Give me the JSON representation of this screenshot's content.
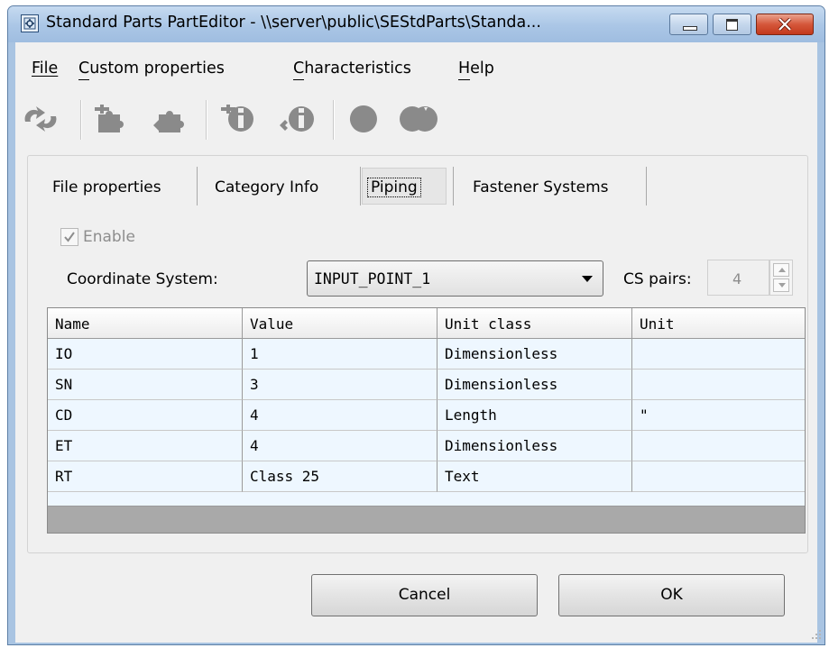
{
  "window": {
    "title": "Standard Parts PartEditor - \\\\server\\public\\SEStdParts\\Standa...",
    "caption_buttons": [
      "minimize",
      "maximize",
      "close"
    ]
  },
  "menu": [
    {
      "label": "File",
      "mnemonic": "F"
    },
    {
      "label": "Custom properties",
      "mnemonic": "C"
    },
    {
      "label": "Characteristics",
      "mnemonic": "C"
    },
    {
      "label": "Help",
      "mnemonic": "H"
    }
  ],
  "toolbar": {
    "icons": [
      "refresh-icon",
      "puzzle-add-icon",
      "puzzle-remove-icon",
      "info-add-icon",
      "info-remove-icon",
      "circle-icon",
      "double-circle-icon"
    ],
    "enabled": false
  },
  "tabs": [
    {
      "label": "File properties",
      "active": false
    },
    {
      "label": "Category Info",
      "active": false
    },
    {
      "label": "Piping",
      "active": true
    },
    {
      "label": "Fastener Systems",
      "active": false
    }
  ],
  "enable": {
    "label": "Enable",
    "checked": true,
    "disabled": true
  },
  "coordinate_system": {
    "label": "Coordinate System:",
    "value": "INPUT_POINT_1"
  },
  "cs_pairs": {
    "label": "CS pairs:",
    "value": "4"
  },
  "grid": {
    "columns": [
      "Name",
      "Value",
      "Unit class",
      "Unit"
    ],
    "rows": [
      [
        "IO",
        "1",
        "Dimensionless",
        ""
      ],
      [
        "SN",
        "3",
        "Dimensionless",
        ""
      ],
      [
        "CD",
        "4",
        "Length",
        "\""
      ],
      [
        "ET",
        "4",
        "Dimensionless",
        ""
      ],
      [
        "RT",
        "Class 25",
        "Text",
        ""
      ]
    ]
  },
  "buttons": {
    "cancel": "Cancel",
    "ok": "OK"
  },
  "colors": {
    "titlebar": "#aac6e6",
    "client_bg": "#f0f0f0",
    "grid_row_bg": "#eef7ff",
    "grid_empty_bg": "#a9a9a9",
    "close_button": "#d5573b"
  }
}
